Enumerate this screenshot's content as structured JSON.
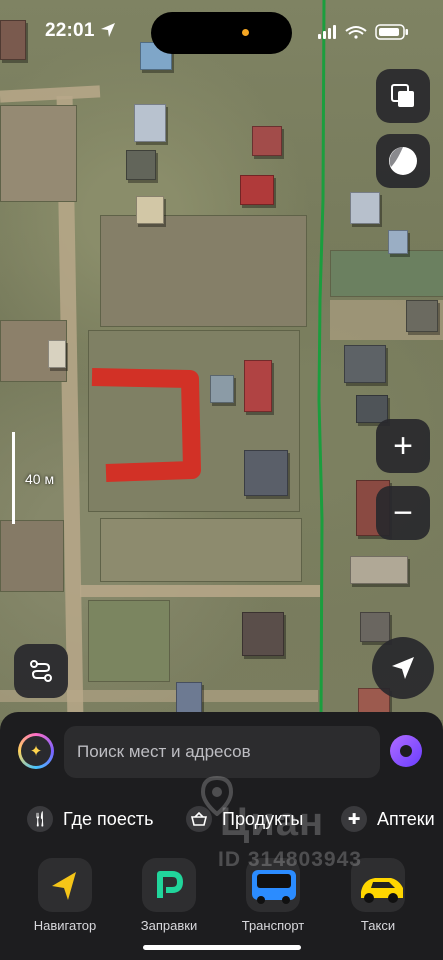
{
  "status_bar": {
    "time": "22:01"
  },
  "map": {
    "scale_label": "40 м",
    "plot_color": "#e0231b",
    "route_color": "#1b9e3e",
    "buttons": {
      "layers": "layers-icon",
      "night": "theme-icon",
      "zoom_in": "+",
      "zoom_out": "−",
      "route": "route-icon",
      "locate": "locate-icon"
    }
  },
  "sheet": {
    "search_placeholder": "Поиск мест и адресов",
    "categories": [
      {
        "label": "Где поесть",
        "icon": "fork-knife-icon"
      },
      {
        "label": "Продукты",
        "icon": "basket-icon"
      },
      {
        "label": "Аптеки",
        "icon": "cross-icon"
      }
    ],
    "apps": [
      {
        "label": "Навигатор",
        "icon": "navigator-icon",
        "color": "#f5c518"
      },
      {
        "label": "Заправки",
        "icon": "fuel-icon",
        "color": "#21d59b"
      },
      {
        "label": "Транспорт",
        "icon": "bus-icon",
        "color": "#2b8cff"
      },
      {
        "label": "Такси",
        "icon": "taxi-icon",
        "color": "#ffd600"
      }
    ]
  },
  "watermark": {
    "brand": "Циан",
    "id": "ID 314803943"
  }
}
